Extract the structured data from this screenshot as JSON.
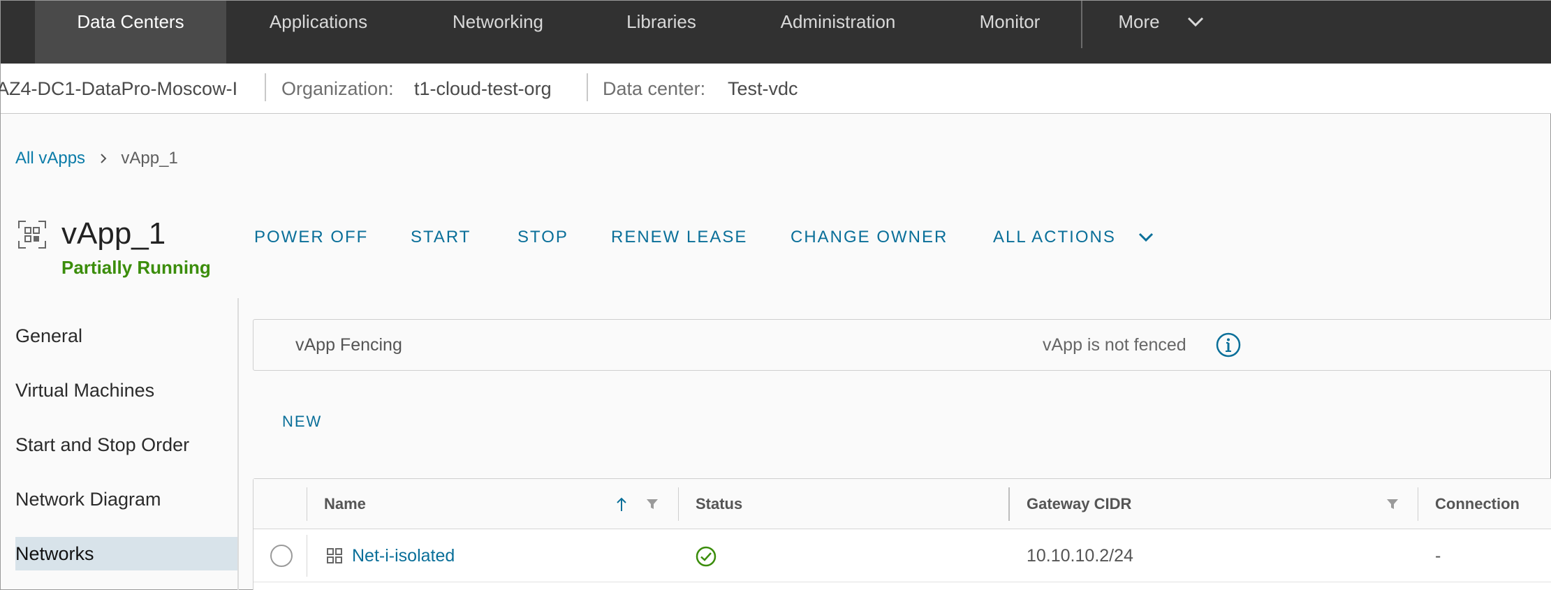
{
  "topnav": {
    "items": [
      {
        "label": "Data Centers",
        "active": true
      },
      {
        "label": "Applications"
      },
      {
        "label": "Networking"
      },
      {
        "label": "Libraries"
      },
      {
        "label": "Administration"
      },
      {
        "label": "Monitor"
      },
      {
        "label": "More"
      }
    ]
  },
  "context": {
    "site": "AZ4-DC1-DataPro-Moscow-I",
    "org_label": "Organization:",
    "org_value": "t1-cloud-test-org",
    "dc_label": "Data center:",
    "dc_value": "Test-vdc"
  },
  "breadcrumb": {
    "parent": "All vApps",
    "current": "vApp_1"
  },
  "vapp": {
    "name": "vApp_1",
    "status": "Partially Running",
    "status_color": "#3b8d0b"
  },
  "actions": {
    "power_off": "POWER OFF",
    "start": "START",
    "stop": "STOP",
    "renew_lease": "RENEW LEASE",
    "change_owner": "CHANGE OWNER",
    "all_actions": "ALL ACTIONS"
  },
  "sidebar": {
    "items": [
      {
        "label": "General"
      },
      {
        "label": "Virtual Machines"
      },
      {
        "label": "Start and Stop Order"
      },
      {
        "label": "Network Diagram"
      },
      {
        "label": "Networks",
        "active": true
      }
    ]
  },
  "fencing": {
    "label": "vApp Fencing",
    "value": "vApp is not fenced",
    "icon": "info-icon"
  },
  "networks": {
    "new_label": "NEW",
    "columns": [
      "Name",
      "Status",
      "Gateway CIDR",
      "Connection"
    ],
    "sort": "ascending",
    "rows": [
      {
        "name": "Net-i-isolated",
        "status": "ok",
        "gateway_cidr": "10.10.10.2/24",
        "connection": "-"
      }
    ]
  },
  "colors": {
    "accent": "#0a6f99",
    "nav_bg": "#313131",
    "success": "#3b8d0b"
  }
}
